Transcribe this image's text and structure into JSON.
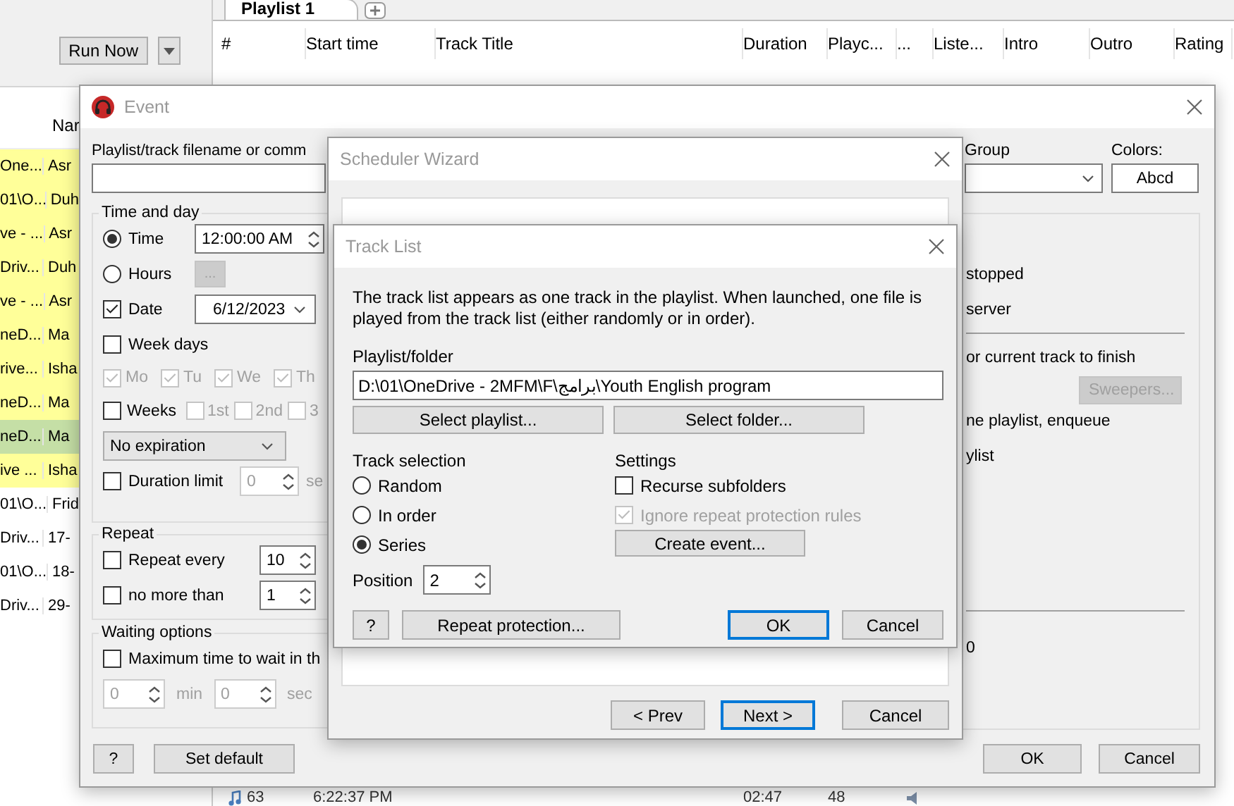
{
  "app": {
    "run_now": "Run Now",
    "list_header": "Nar",
    "list_rows": [
      {
        "cells": [
          "One...",
          "Asr"
        ],
        "highlighted": true,
        "selected": false
      },
      {
        "cells": [
          "01\\O...",
          "Duh"
        ],
        "highlighted": true,
        "selected": false
      },
      {
        "cells": [
          "ve - ...",
          "Asr"
        ],
        "highlighted": true,
        "selected": false
      },
      {
        "cells": [
          "Driv...",
          "Duh"
        ],
        "highlighted": true,
        "selected": false
      },
      {
        "cells": [
          "ve - ...",
          "Asr"
        ],
        "highlighted": true,
        "selected": false
      },
      {
        "cells": [
          "neD...",
          "Ma"
        ],
        "highlighted": true,
        "selected": false
      },
      {
        "cells": [
          "rive...",
          "Isha"
        ],
        "highlighted": true,
        "selected": false
      },
      {
        "cells": [
          "neD...",
          "Ma"
        ],
        "highlighted": true,
        "selected": false
      },
      {
        "cells": [
          "neD...",
          "Ma"
        ],
        "highlighted": true,
        "selected": true
      },
      {
        "cells": [
          "ive ...",
          "Isha"
        ],
        "highlighted": true,
        "selected": false
      },
      {
        "cells": [
          "01\\O...",
          "Frid"
        ],
        "highlighted": false,
        "selected": false
      },
      {
        "cells": [
          "Driv...",
          "17-"
        ],
        "highlighted": false,
        "selected": false
      },
      {
        "cells": [
          "01\\O...",
          "18-"
        ],
        "highlighted": false,
        "selected": false
      },
      {
        "cells": [
          "Driv...",
          "29-"
        ],
        "highlighted": false,
        "selected": false
      }
    ],
    "tabs": [
      {
        "label": "Playlist 1",
        "selected": true
      }
    ],
    "columns": [
      "#",
      "Start time",
      "Track Title",
      "Duration",
      "Playc...",
      "...",
      "Liste...",
      "Intro",
      "Outro",
      "Rating"
    ],
    "last_row": {
      "number": "63",
      "start_time": "6:22:37 PM",
      "duration": "02:47",
      "playcount": "48"
    }
  },
  "event": {
    "title": "Event",
    "filename_label": "Playlist/track filename or comm",
    "group_label": "Group",
    "colors_label": "Colors:",
    "colors_sample": "Abcd",
    "time_and_day": {
      "title": "Time and day",
      "modes": [
        {
          "label": "Time",
          "selected": true,
          "value": "12:00:00 AM"
        },
        {
          "label": "Hours",
          "selected": false,
          "button": "..."
        }
      ],
      "date": {
        "label": "Date",
        "checked": true,
        "value": "6/12/2023"
      },
      "week_days": {
        "label": "Week days",
        "checked": false,
        "days": [
          {
            "label": "Mo",
            "checked": true
          },
          {
            "label": "Tu",
            "checked": true
          },
          {
            "label": "We",
            "checked": true
          },
          {
            "label": "Th",
            "checked": true
          }
        ]
      },
      "weeks": {
        "label": "Weeks",
        "checked": false,
        "items": [
          {
            "label": "1st",
            "checked": false
          },
          {
            "label": "2nd",
            "checked": false
          },
          {
            "label": "3",
            "checked": false
          }
        ]
      },
      "expiration": "No expiration",
      "duration_limit": {
        "label": "Duration limit",
        "checked": false,
        "value": "0",
        "unit": "se"
      }
    },
    "repeat": {
      "title": "Repeat",
      "rows": [
        {
          "label": "Repeat every",
          "checked": false,
          "value": "10"
        },
        {
          "label": "no more than",
          "checked": false,
          "value": "1"
        }
      ]
    },
    "waiting": {
      "title": "Waiting options",
      "max_wait": {
        "label": "Maximum time to wait in th",
        "checked": false
      },
      "minutes": "0",
      "min_unit": "min",
      "seconds": "0",
      "sec_unit": "sec"
    },
    "status_texts": [
      "stopped",
      "server",
      "or current track to finish",
      "ne playlist, enqueue",
      "ylist"
    ],
    "sweepers_button": "Sweepers...",
    "count": "0",
    "buttons": {
      "help": "?",
      "set_default": "Set default",
      "ok": "OK",
      "cancel": "Cancel"
    }
  },
  "wizard": {
    "title": "Scheduler Wizard",
    "buttons": {
      "prev": "< Prev",
      "next": "Next >",
      "cancel": "Cancel"
    }
  },
  "track_list": {
    "title": "Track List",
    "description": "The track list appears as one track in the playlist. When launched, one file is played from the track list (either randomly or in order).",
    "folder_label": "Playlist/folder",
    "folder_value": "D:\\01\\OneDrive - 2MFM\\F\\برامج\\Youth English program",
    "select_playlist": "Select playlist...",
    "select_folder": "Select folder...",
    "selection_title": "Track selection",
    "selection": [
      {
        "label": "Random",
        "selected": false
      },
      {
        "label": "In order",
        "selected": false
      },
      {
        "label": "Series",
        "selected": true
      }
    ],
    "position_label": "Position",
    "position_value": "2",
    "settings_title": "Settings",
    "settings": [
      {
        "label": "Recurse subfolders",
        "checked": false,
        "disabled": false
      },
      {
        "label": "Ignore repeat protection rules",
        "checked": true,
        "disabled": true
      }
    ],
    "create_event": "Create event...",
    "buttons": {
      "help": "?",
      "repeat_protection": "Repeat protection...",
      "ok": "OK",
      "cancel": "Cancel"
    }
  }
}
